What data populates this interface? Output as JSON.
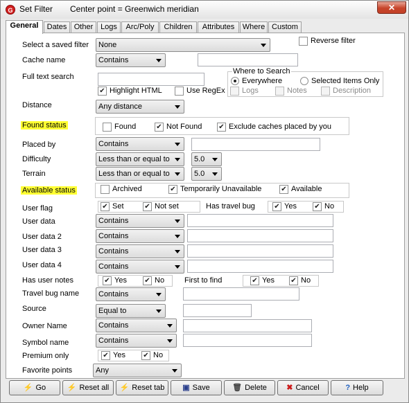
{
  "window": {
    "title": "Set Filter",
    "subtitle": "Center point = Greenwich meridian",
    "close": "✕"
  },
  "tabs": [
    "General",
    "Dates",
    "Other",
    "Logs",
    "Arc/Poly",
    "Children",
    "Attributes",
    "Where",
    "Custom"
  ],
  "general": {
    "saved_filter_label": "Select a saved filter",
    "saved_filter_value": "None",
    "reverse_filter": "Reverse filter",
    "cache_name_label": "Cache name",
    "cache_name_op": "Contains",
    "full_text_label": "Full text search",
    "highlight_html": "Highlight HTML",
    "use_regex": "Use RegEx",
    "where_to_search": "Where to Search",
    "everywhere": "Everywhere",
    "selected_only": "Selected Items Only",
    "logs": "Logs",
    "notes": "Notes",
    "description": "Description",
    "distance_label": "Distance",
    "distance_value": "Any distance",
    "found_status_label": "Found status",
    "found": "Found",
    "not_found": "Not Found",
    "exclude_caches": "Exclude caches placed by you",
    "placed_by_label": "Placed by",
    "placed_by_op": "Contains",
    "difficulty_label": "Difficulty",
    "difficulty_op": "Less than or equal to",
    "difficulty_value": "5.0",
    "terrain_label": "Terrain",
    "terrain_op": "Less than or equal to",
    "terrain_value": "5.0",
    "available_status_label": "Available status",
    "archived": "Archived",
    "temp_unavailable": "Temporarily Unavailable",
    "available": "Available",
    "user_flag_label": "User flag",
    "set": "Set",
    "not_set": "Not set",
    "has_travel_bug_label": "Has travel bug",
    "yes": "Yes",
    "no": "No",
    "user_data_label": "User data",
    "user_data2_label": "User data 2",
    "user_data3_label": "User data 3",
    "user_data4_label": "User data 4",
    "contains": "Contains",
    "has_user_notes_label": "Has user notes",
    "first_to_find_label": "First to find",
    "travel_bug_name_label": "Travel bug name",
    "source_label": "Source",
    "source_op": "Equal to",
    "owner_name_label": "Owner Name",
    "symbol_name_label": "Symbol name",
    "premium_only_label": "Premium only",
    "favorite_points_label": "Favorite points",
    "favorite_points_value": "Any"
  },
  "buttons": {
    "go": "Go",
    "reset_all": "Reset all",
    "reset_tab": "Reset tab",
    "save": "Save",
    "delete": "Delete",
    "cancel": "Cancel",
    "help": "Help"
  },
  "colors": {
    "highlight": "#ffff33",
    "close": "#c7442a"
  }
}
